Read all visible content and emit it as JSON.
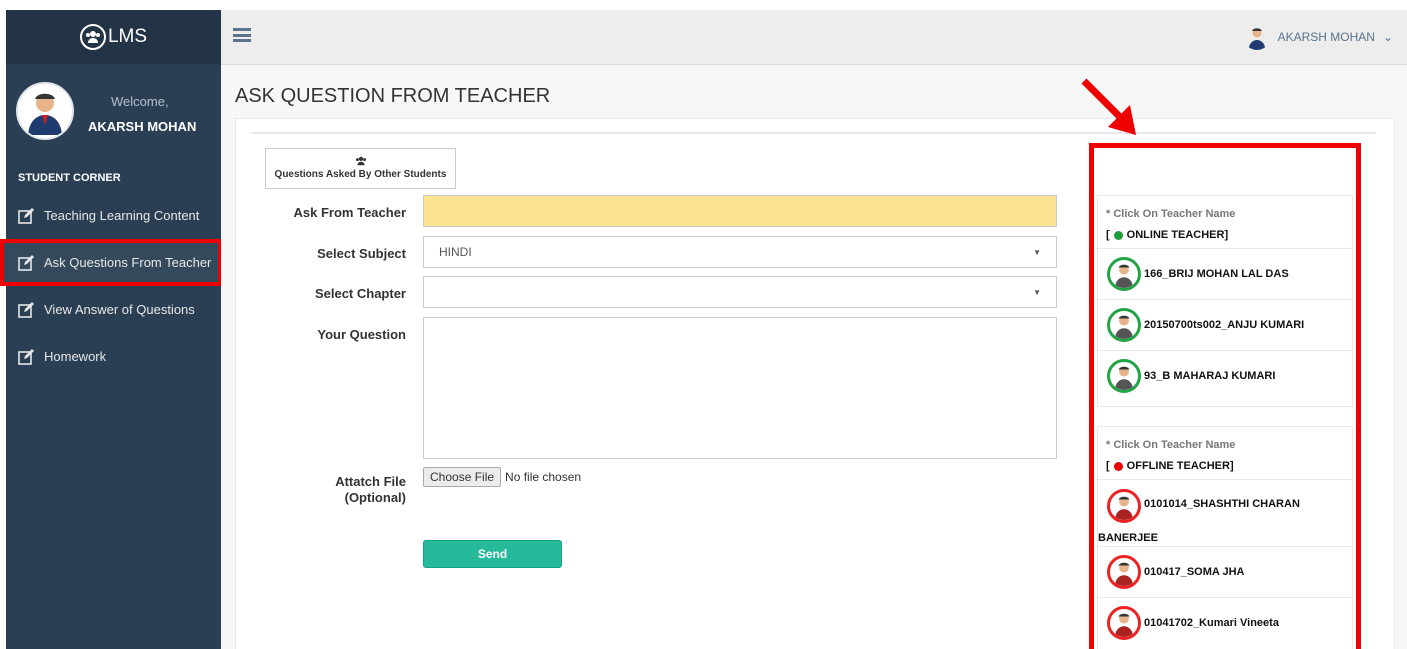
{
  "brand": {
    "name": "LMS",
    "icon": "users-icon"
  },
  "user": {
    "welcome": "Welcome,",
    "name": "AKARSH MOHAN",
    "menu_label": "AKARSH MOHAN",
    "menu_caret": "⌄"
  },
  "sidebar": {
    "section_title": "STUDENT CORNER",
    "items": [
      {
        "label": "Teaching Learning Content",
        "icon": "edit-icon"
      },
      {
        "label": "Ask Questions From Teacher",
        "icon": "edit-icon",
        "active": true
      },
      {
        "label": "View Answer of Questions",
        "icon": "edit-icon"
      },
      {
        "label": "Homework",
        "icon": "edit-icon"
      }
    ]
  },
  "page": {
    "title": "ASK QUESTION FROM TEACHER"
  },
  "form": {
    "other_questions_btn": "Questions Asked By Other Students",
    "ask_label": "Ask From Teacher",
    "ask_value": "",
    "subject_label": "Select Subject",
    "subject_value": "HINDI",
    "chapter_label": "Select Chapter",
    "chapter_value": "",
    "question_label": "Your Question",
    "question_value": "",
    "file_label_1": "Attatch File",
    "file_label_2": "(Optional)",
    "file_button": "Choose File",
    "file_status": "No file chosen",
    "send_label": "Send"
  },
  "teachers": {
    "online": {
      "hint": "* Click On Teacher Name",
      "status": "ONLINE TEACHER]",
      "bracket": "[",
      "list": [
        "166_BRIJ MOHAN LAL DAS",
        "20150700ts002_ANJU KUMARI",
        "93_B MAHARAJ KUMARI"
      ]
    },
    "offline": {
      "hint": "* Click On Teacher Name",
      "status": "OFFLINE TEACHER]",
      "bracket": "[",
      "list_first_a": "0101014_SHASHTHI CHARAN",
      "list_first_b": "BANERJEE",
      "list": [
        "010417_SOMA JHA",
        "01041702_Kumari Vineeta"
      ]
    }
  },
  "colors": {
    "accent_green": "#26b99a",
    "sidebar_bg": "#2a3f54",
    "highlight_red": "#ef0000",
    "ask_field_bg": "#fce391"
  }
}
